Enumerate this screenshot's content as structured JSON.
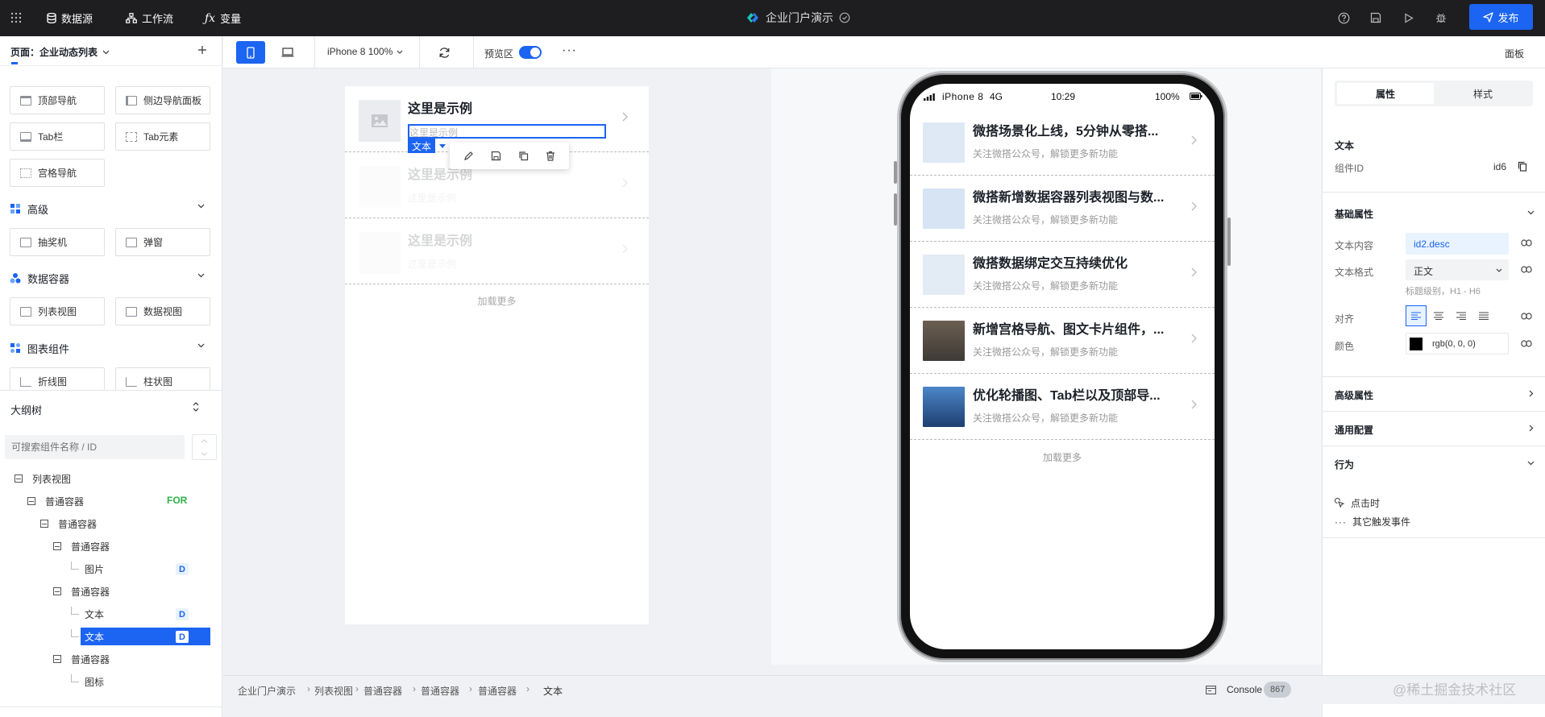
{
  "topbar": {
    "nav": [
      {
        "label": "数据源",
        "icon": "database-icon"
      },
      {
        "label": "工作流",
        "icon": "workflow-icon"
      },
      {
        "label": "变量",
        "icon": "fx-icon"
      }
    ],
    "app_title": "企业门户演示",
    "publish_label": "发布"
  },
  "left": {
    "page_label": "页面：企业动态列表",
    "components": {
      "nav_items": [
        "顶部导航",
        "侧边导航面板",
        "Tab栏",
        "Tab元素",
        "宫格导航"
      ],
      "advanced_title": "高级",
      "advanced_items": [
        "抽奖机",
        "弹窗"
      ],
      "data_container_title": "数据容器",
      "data_container_items": [
        "列表视图",
        "数据视图"
      ],
      "chart_title": "图表组件",
      "chart_items": [
        "折线图",
        "柱状图"
      ]
    },
    "outline": {
      "title": "大纲树",
      "search_placeholder": "可搜索组件名称 / ID",
      "nodes": [
        {
          "label": "列表视图",
          "badge": ""
        },
        {
          "label": "普通容器",
          "badge": "FOR"
        },
        {
          "label": "普通容器",
          "badge": ""
        },
        {
          "label": "普通容器",
          "badge": ""
        },
        {
          "label": "图片",
          "badge": "D"
        },
        {
          "label": "普通容器",
          "badge": ""
        },
        {
          "label": "文本",
          "badge": "D"
        },
        {
          "label": "文本",
          "badge": "D"
        },
        {
          "label": "普通容器",
          "badge": ""
        },
        {
          "label": "图标",
          "badge": ""
        }
      ]
    }
  },
  "toolbar": {
    "device": "iPhone 8 100%",
    "preview_label": "预览区",
    "panel_label": "面板"
  },
  "editor": {
    "item_title": "这里是示例",
    "item_desc": "这里是示例",
    "selected_tag": "文本",
    "load_more": "加载更多"
  },
  "phone": {
    "status": {
      "carrier": "iPhone 8",
      "network": "4G",
      "time": "10:29",
      "battery": "100%"
    },
    "items": [
      {
        "title": "微搭场景化上线，5分钟从零搭...",
        "desc": "关注微搭公众号，解锁更多新功能",
        "thumb": "#dfe9f5"
      },
      {
        "title": "微搭新增数据容器列表视图与数...",
        "desc": "关注微搭公众号，解锁更多新功能",
        "thumb": "#d6e4f4"
      },
      {
        "title": "微搭数据绑定交互持续优化",
        "desc": "关注微搭公众号，解锁更多新功能",
        "thumb": "#e3ebf5"
      },
      {
        "title": "新增宫格导航、图文卡片组件，...",
        "desc": "关注微搭公众号，解锁更多新功能",
        "thumb": "#5a5248"
      },
      {
        "title": "优化轮播图、Tab栏以及顶部导...",
        "desc": "关注微搭公众号，解锁更多新功能",
        "thumb": "#2e5b93"
      }
    ],
    "load_more": "加载更多"
  },
  "right": {
    "tabs": [
      "属性",
      "样式"
    ],
    "component_name": "文本",
    "component_id_label": "组件ID",
    "component_id": "id6",
    "basic_title": "基础属性",
    "text_content_label": "文本内容",
    "text_content_value": "id2.desc",
    "text_format_label": "文本格式",
    "text_format_value": "正文",
    "text_format_hint": "标题级别，H1 - H6",
    "align_label": "对齐",
    "color_label": "颜色",
    "color_value": "rgb(0, 0, 0)",
    "advanced_title": "高级属性",
    "common_title": "通用配置",
    "behavior_title": "行为",
    "on_click": "点击时",
    "other_events": "其它触发事件"
  },
  "bottom": {
    "breadcrumb": [
      "企业门户演示",
      "列表视图",
      "普通容器",
      "普通容器",
      "普通容器",
      "文本"
    ],
    "console_label": "Console",
    "console_count": "867"
  },
  "watermark": "@稀土掘金技术社区"
}
